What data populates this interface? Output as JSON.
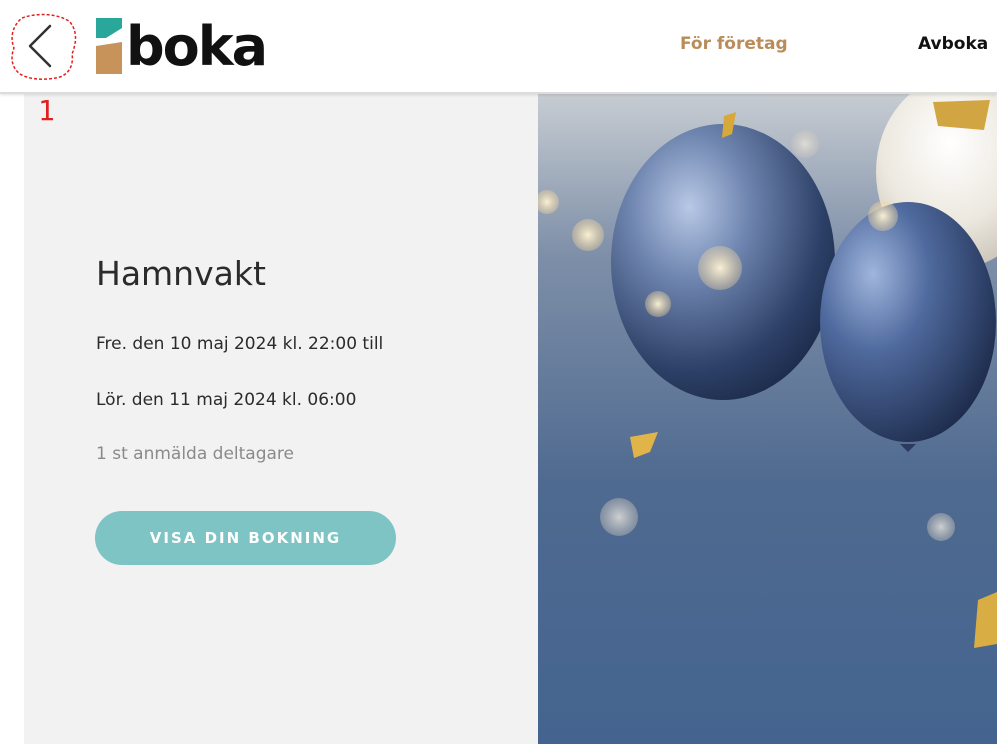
{
  "header": {
    "logo_text": "boka",
    "nav": {
      "for_companies": "För företag",
      "cancel": "Avboka"
    }
  },
  "annotation": {
    "step_number": "1"
  },
  "event": {
    "title": "Hamnvakt",
    "start": "Fre. den 10 maj 2024 kl. 22:00 till",
    "end": "Lör. den 11 maj 2024 kl. 06:00",
    "participants": "1 st anmälda deltagare",
    "view_booking_label": "VISA DIN BOKNING"
  },
  "colors": {
    "brand_teal": "#2aa79b",
    "brand_tan": "#c8935b",
    "nav_accent": "#b98c5a",
    "button_teal": "#7ec4c4",
    "annotation_red": "#e0201f"
  },
  "icons": {
    "back": "chevron-left-icon",
    "logo_mark": "boka-logo-mark"
  }
}
